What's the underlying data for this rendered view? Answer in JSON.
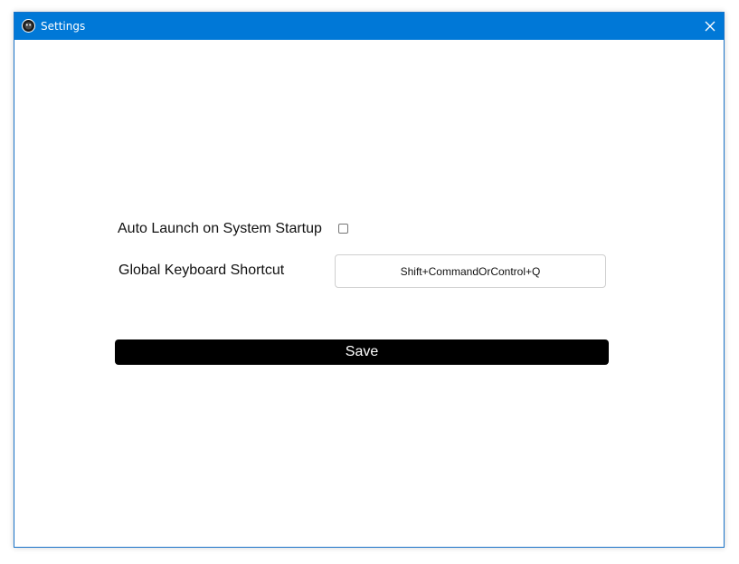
{
  "window": {
    "title": "Settings",
    "titlebar_color": "#0078d7",
    "app_icon": "app-logo-icon",
    "close_icon": "close-icon"
  },
  "settings": {
    "auto_launch_label": "Auto Launch on System Startup",
    "auto_launch_checked": false,
    "shortcut_label": "Global Keyboard Shortcut",
    "shortcut_value": "Shift+CommandOrControl+Q"
  },
  "actions": {
    "save_label": "Save"
  }
}
